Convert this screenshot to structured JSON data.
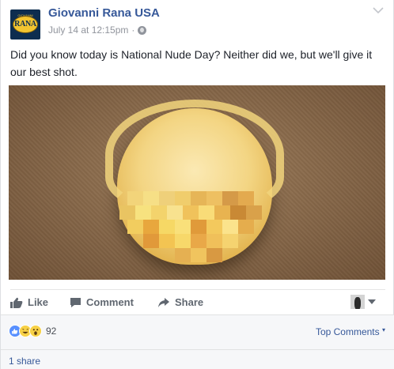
{
  "post": {
    "page_name": "Giovanni Rana USA",
    "timestamp": "July 14 at 12:15pm",
    "separator": "·",
    "privacy_icon": "globe-icon",
    "options_icon": "chevron-down-icon",
    "text": "Did you know today is National Nude Day? Neither did we, but we'll give it our best shot.",
    "avatar_logo_text": "RANA",
    "avatar_logo_subtext": "GIOVANNI"
  },
  "photo": {
    "subject": "tortellini-pasta-pixelated"
  },
  "actions": {
    "like_label": "Like",
    "comment_label": "Comment",
    "share_label": "Share",
    "like_icon": "thumbs-up-icon",
    "comment_icon": "speech-bubble-icon",
    "share_icon": "share-arrow-icon"
  },
  "reactions": {
    "types": [
      "like",
      "haha",
      "wow"
    ],
    "count": "92",
    "sort_label": "Top Comments"
  },
  "shares": {
    "label": "1 share"
  },
  "colors": {
    "link_blue": "#365899",
    "meta_gray": "#90949c",
    "like_blue": "#5890ff",
    "reaction_yellow": "#f7d147"
  }
}
